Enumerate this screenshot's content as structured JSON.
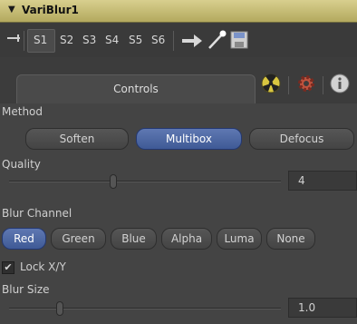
{
  "tool": {
    "title": "VariBlur1"
  },
  "toolbar": {
    "slots": [
      "S1",
      "S2",
      "S3",
      "S4",
      "S5",
      "S6"
    ]
  },
  "tabs": {
    "controls_label": "Controls"
  },
  "method": {
    "label": "Method",
    "options": [
      "Soften",
      "Multibox",
      "Defocus"
    ],
    "selected": "Multibox"
  },
  "quality": {
    "label": "Quality",
    "value": "4"
  },
  "blur_channel": {
    "label": "Blur Channel",
    "options": [
      "Red",
      "Green",
      "Blue",
      "Alpha",
      "Luma",
      "None"
    ],
    "selected": "Red"
  },
  "lock_xy": {
    "label": "Lock X/Y",
    "checked": true
  },
  "blur_size": {
    "label": "Blur Size",
    "value": "1.0"
  },
  "colors": {
    "title_bar": "#c8bf74",
    "active_button": "#4d67a5",
    "panel": "#444444"
  }
}
